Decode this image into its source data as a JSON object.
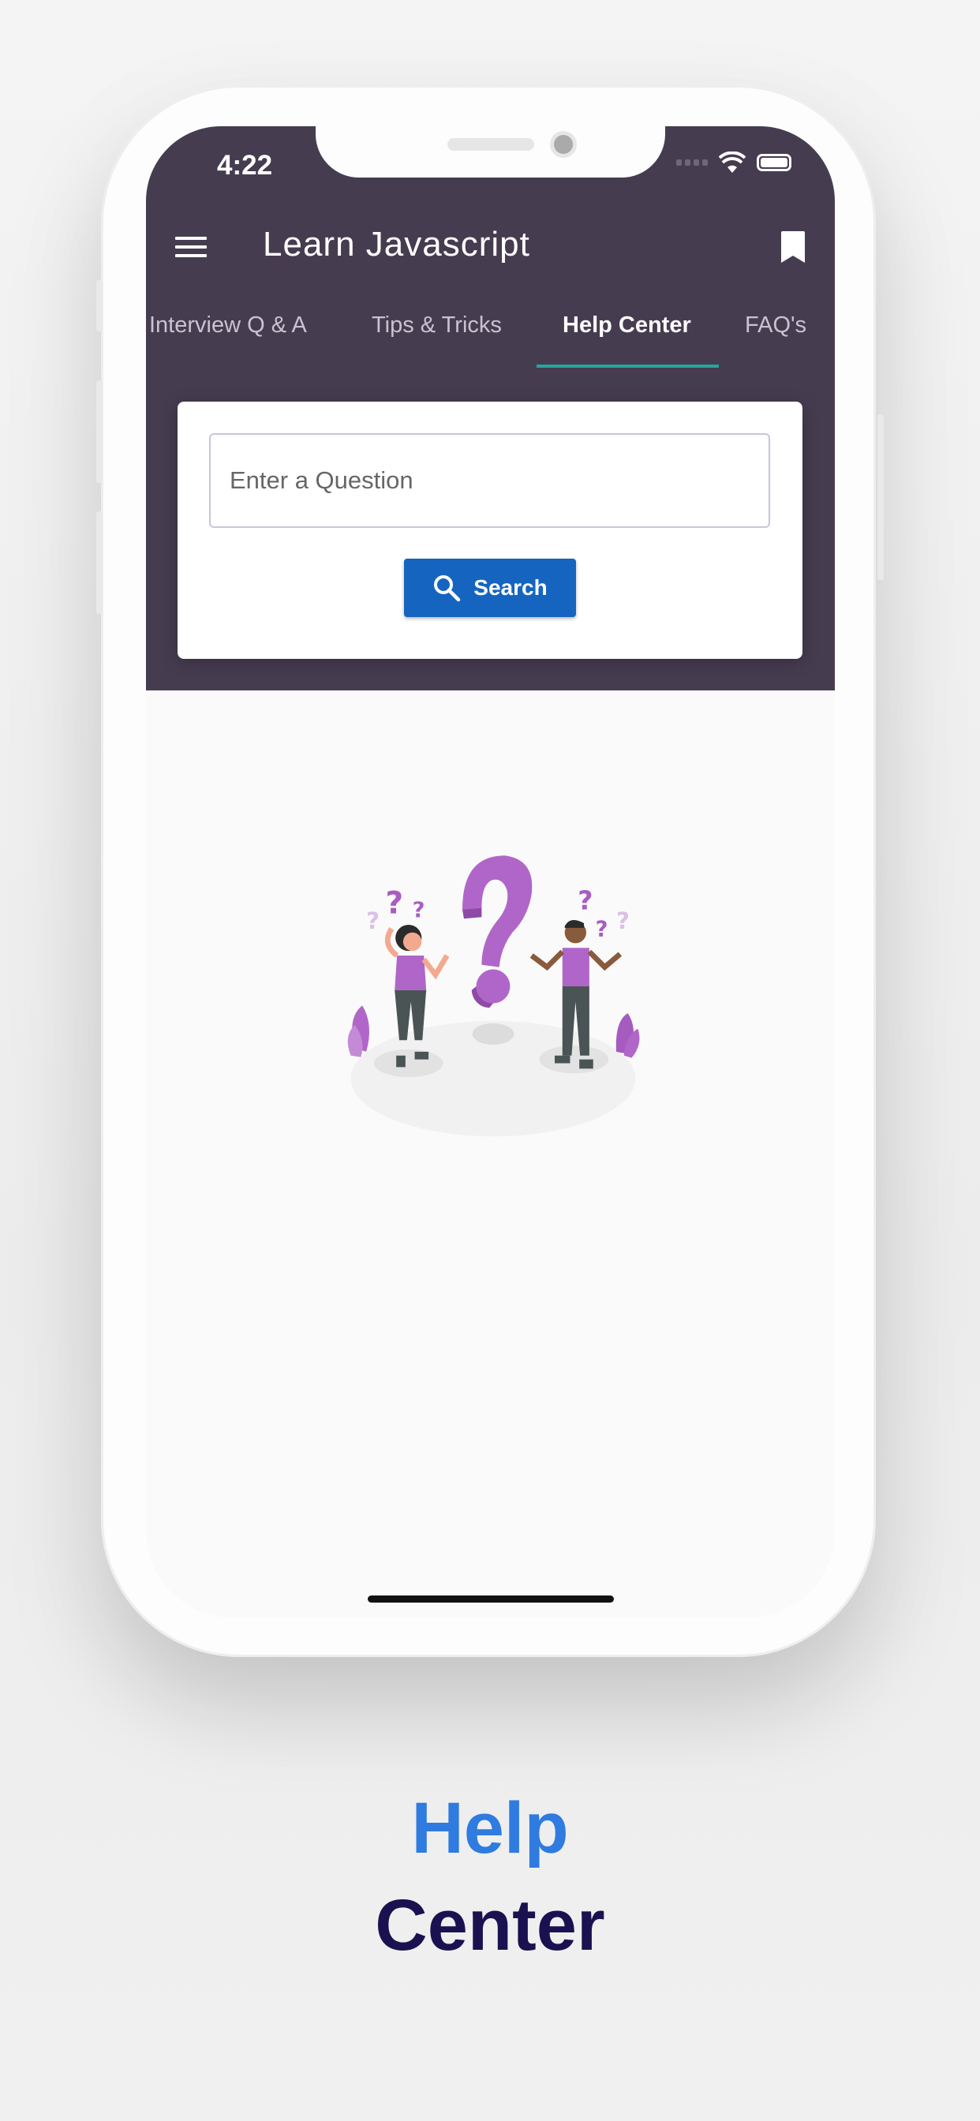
{
  "status_bar": {
    "time": "4:22"
  },
  "app_bar": {
    "title": "Learn Javascript",
    "menu_icon": "hamburger-icon",
    "action_icon": "bookmark-icon"
  },
  "tabs": [
    {
      "label": "Interview Q & A",
      "active": false
    },
    {
      "label": "Tips & Tricks",
      "active": false
    },
    {
      "label": "Help Center",
      "active": true
    },
    {
      "label": "FAQ's",
      "active": false
    }
  ],
  "search": {
    "placeholder": "Enter a Question",
    "value": "",
    "button_label": "Search",
    "button_icon": "search-icon"
  },
  "caption": {
    "line1": "Help",
    "line2": "Center"
  },
  "colors": {
    "header": "#463c50",
    "tab_indicator": "#26a69a",
    "button": "#1565c0",
    "caption_line1": "#2f7be0",
    "caption_line2": "#1a1150",
    "illustration_accent": "#b066c8"
  }
}
